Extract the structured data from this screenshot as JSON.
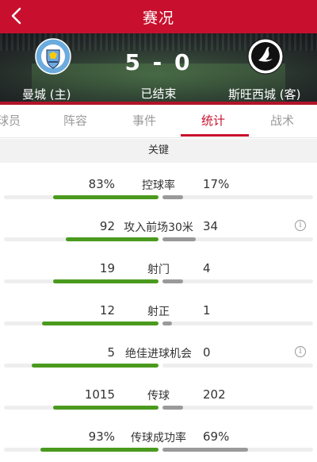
{
  "header": {
    "title": "赛况",
    "back_icon": "chevron-left-icon"
  },
  "match": {
    "home_name": "曼城 (主)",
    "away_name": "斯旺西城 (客)",
    "score": "5 - 0",
    "status": "已结束",
    "home_logo": "manchester-city-crest",
    "away_logo": "swansea-city-crest",
    "home_logo_text": "MANCHESTER CITY",
    "away_logo_text": "SWANSEA CITY AFC"
  },
  "tabs": [
    {
      "label": "球员"
    },
    {
      "label": "阵容"
    },
    {
      "label": "事件"
    },
    {
      "label": "统计",
      "active": true
    },
    {
      "label": "战术"
    }
  ],
  "section": {
    "title": "关键"
  },
  "colors": {
    "accent": "#c8102e",
    "home_bar": "#4a9a1e",
    "away_bar": "#9a9a9a"
  },
  "stats": [
    {
      "label": "控球率",
      "home": "83%",
      "away": "17%",
      "home_share": 0.83,
      "away_share": 0.17,
      "info": false
    },
    {
      "label": "攻入前场30米",
      "home": "92",
      "away": "34",
      "home_share": 0.73,
      "away_share": 0.27,
      "info": true
    },
    {
      "label": "射门",
      "home": "19",
      "away": "4",
      "home_share": 0.83,
      "away_share": 0.17,
      "info": false
    },
    {
      "label": "射正",
      "home": "12",
      "away": "1",
      "home_share": 0.92,
      "away_share": 0.08,
      "info": false
    },
    {
      "label": "绝佳进球机会",
      "home": "5",
      "away": "0",
      "home_share": 1.0,
      "away_share": 0.0,
      "info": true
    },
    {
      "label": "传球",
      "home": "1015",
      "away": "202",
      "home_share": 0.83,
      "away_share": 0.17,
      "info": false
    },
    {
      "label": "传球成功率",
      "home": "93%",
      "away": "69%",
      "home_share": 0.93,
      "away_share": 0.69,
      "info": false
    }
  ]
}
